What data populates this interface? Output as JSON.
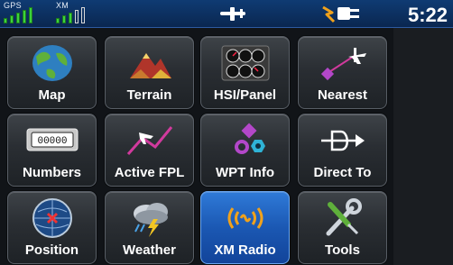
{
  "status_bar": {
    "gps_label": "GPS",
    "gps_signal_bars": 5,
    "xm_label": "XM",
    "xm_signal_bars": 3,
    "time": "5:22",
    "icons": [
      "airplane-icon",
      "power-plug-icon"
    ]
  },
  "colors": {
    "status_bar": "#0f3b73",
    "tile": "#2a2e33",
    "tile_selected": "#1b58b3",
    "signal_on": "#3bd43b"
  },
  "menu": {
    "tiles": [
      {
        "label": "Map",
        "icon": "map-globe-icon"
      },
      {
        "label": "Terrain",
        "icon": "terrain-mountain-icon"
      },
      {
        "label": "HSI/Panel",
        "icon": "hsi-panel-icon"
      },
      {
        "label": "Nearest",
        "icon": "nearest-airport-icon"
      },
      {
        "label": "Numbers",
        "icon": "numbers-counter-icon"
      },
      {
        "label": "Active FPL",
        "icon": "active-flightplan-icon"
      },
      {
        "label": "WPT Info",
        "icon": "waypoint-info-icon"
      },
      {
        "label": "Direct To",
        "icon": "direct-to-icon"
      },
      {
        "label": "Position",
        "icon": "position-crosshair-icon"
      },
      {
        "label": "Weather",
        "icon": "weather-storm-icon"
      },
      {
        "label": "XM Radio",
        "icon": "xm-radio-icon"
      },
      {
        "label": "Tools",
        "icon": "tools-wrench-screwdriver-icon"
      }
    ],
    "selected": "XM Radio",
    "numbers_display": "00000"
  }
}
